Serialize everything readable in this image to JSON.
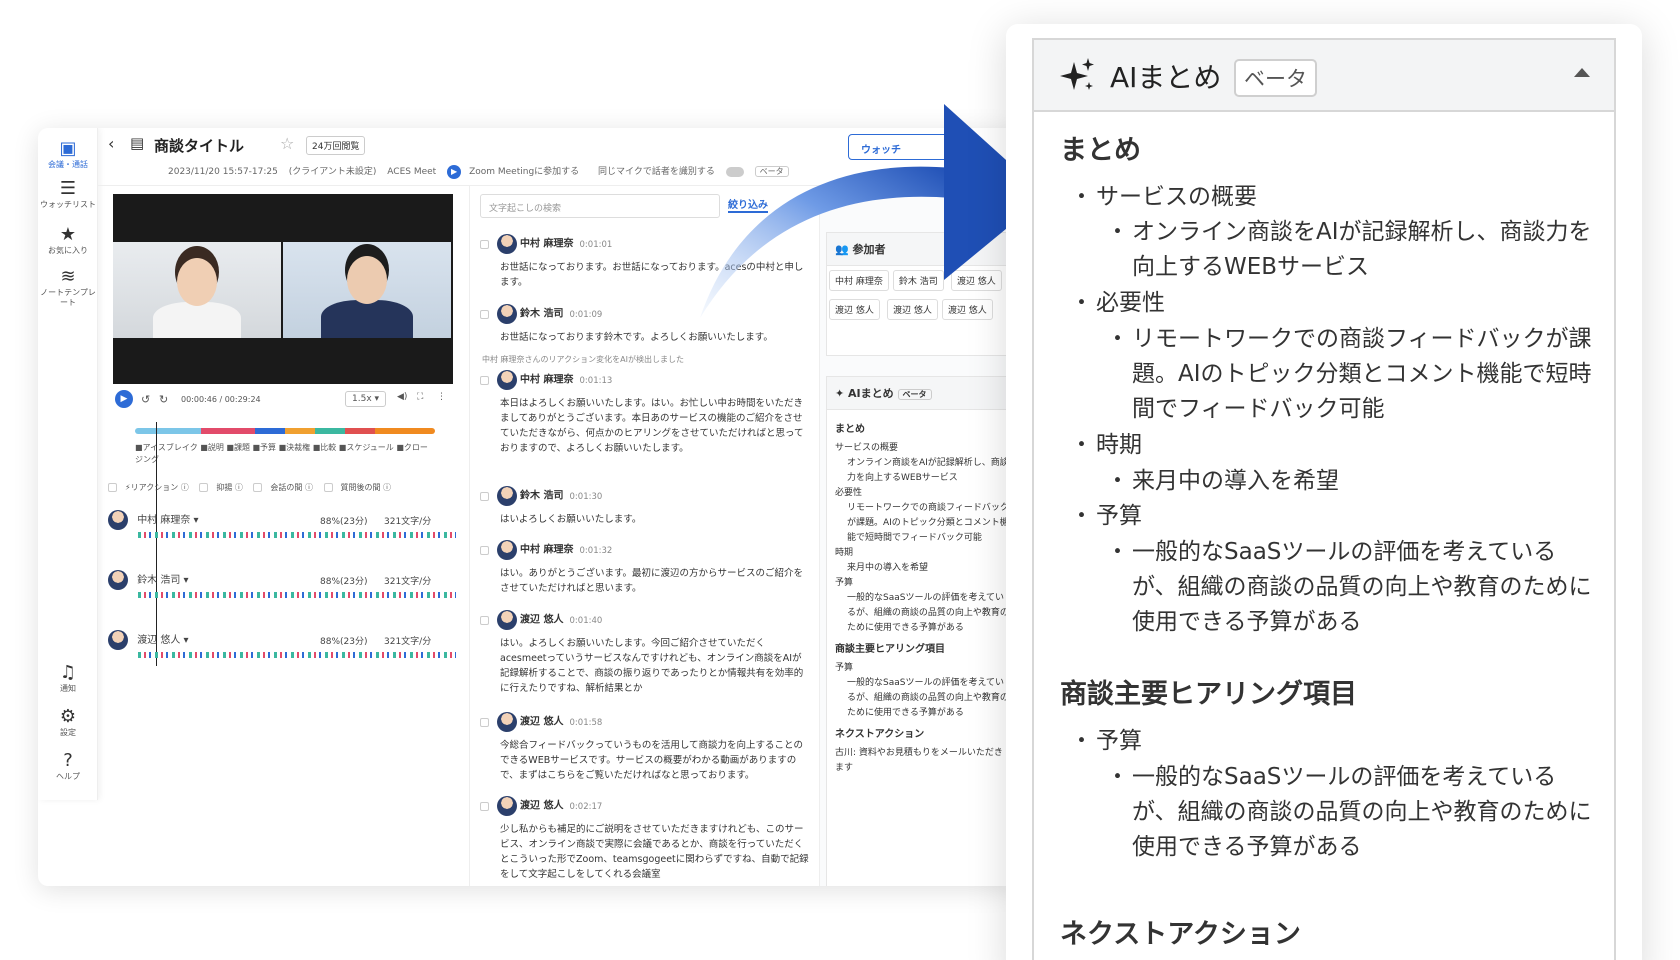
{
  "app": {
    "rail": [
      {
        "icon": "calendar-icon",
        "label": "会議・通話",
        "active": true
      },
      {
        "icon": "list-icon",
        "label": "ウォッチリスト"
      },
      {
        "icon": "star-icon",
        "label": "お気に入り"
      },
      {
        "icon": "database-icon",
        "label": "ノートテンプレート"
      },
      {
        "icon": "bell-icon",
        "label": "通知"
      },
      {
        "icon": "gear-icon",
        "label": "設定"
      },
      {
        "icon": "help-icon",
        "label": "ヘルプ"
      }
    ],
    "header": {
      "title": "商談タイトル",
      "views": "24万回閲覧",
      "datetime": "2023/11/20 15:57-17:25",
      "client": "(クライアント未設定)",
      "tag": "ACES Meet",
      "zoom": "Zoom Meetingに参加する",
      "mic_toggle": "同じマイクで話者を識別する",
      "beta": "ベータ",
      "watch_button": "ウォッチ"
    },
    "player": {
      "time": "00:00:46 / 00:29:24",
      "speed": "1.5x"
    },
    "legend": "■アイスブレイク ■説明 ■課題 ■予算 ■決裁権 ■比較 ■スケジュール ■クロージング",
    "filters": [
      "リアクション",
      "抑揚",
      "会話の間",
      "質問後の間"
    ],
    "speakers": [
      {
        "name": "中村 麻理奈",
        "ratio": "88%(23分)",
        "speed": "321文字/分"
      },
      {
        "name": "鈴木 浩司",
        "ratio": "88%(23分)",
        "speed": "321文字/分"
      },
      {
        "name": "渡辺 悠人",
        "ratio": "88%(23分)",
        "speed": "321文字/分"
      }
    ],
    "transcript": {
      "search_placeholder": "文字起こしの検索",
      "narrow": "絞り込み",
      "reaction_notice": "中村 麻理奈さんのリアクション変化をAIが検出しました",
      "entries": [
        {
          "name": "中村 麻理奈",
          "time": "0:01:01",
          "text": "お世話になっております。お世話になっております。acesの中村と申します。"
        },
        {
          "name": "鈴木 浩司",
          "time": "0:01:09",
          "text": "お世話になっております鈴木です。よろしくお願いいたします。"
        },
        {
          "name": "中村 麻理奈",
          "time": "0:01:13",
          "text": "本日はよろしくお願いいたします。はい。お忙しい中お時間をいただきましてありがとうございます。本日あのサービスの機能のご紹介をさせていただきながら、何点かのヒアリングをさせていただければと思っておりますので、よろしくお願いいたします。"
        },
        {
          "name": "鈴木 浩司",
          "time": "0:01:30",
          "text": "はいよろしくお願いいたします。"
        },
        {
          "name": "中村 麻理奈",
          "time": "0:01:32",
          "text": "はい。ありがとうございます。最初に渡辺の方からサービスのご紹介をさせていただければと思います。"
        },
        {
          "name": "渡辺 悠人",
          "time": "0:01:40",
          "text": "はい。よろしくお願いいたします。今回ご紹介させていただくacesmeetっていうサービスなんですけれども、オンライン商談をAIが記録解析することで、商談の振り返りであったりとか情報共有を効率的に行えたりですね、解析結果とか"
        },
        {
          "name": "渡辺 悠人",
          "time": "0:01:58",
          "text": "今総合フィードバックっていうものを活用して商談力を向上することのできるWEBサービスです。サービスの概要がわかる動画がありますので、まずはこちらをご覧いただければなと思っております。"
        },
        {
          "name": "渡辺 悠人",
          "time": "0:02:17",
          "text": "少し私からも補足的にご説明をさせていただきますけれども、このサービス、オンライン商談で実際に会議であるとか、商談を行っていただくとこういった形でZoom、teamsgogeetに関わらずですね、自動で記録をして文字起こしをしてくれる会議室"
        }
      ]
    },
    "participants": {
      "title": "参加者",
      "chips": [
        "中村 麻理奈",
        "鈴木 浩司",
        "渡辺 悠人",
        "渡辺 悠人",
        "渡辺 悠人",
        "渡辺 悠人"
      ]
    },
    "mini_summary": {
      "title": "AIまとめ",
      "beta": "ベータ",
      "section1": "まとめ",
      "items": [
        "サービスの概要",
        "オンライン商談をAIが記録解析し、商談力を向上するWEBサービス",
        "必要性",
        "リモートワークでの商談フィードバックが課題。AIのトピック分類とコメント機能で短時間でフィードバック可能",
        "時期",
        "来月中の導入を希望",
        "予算",
        "一般的なSaaSツールの評価を考えているが、組織の商談の品質の向上や教育のために使用できる予算がある"
      ],
      "section2": "商談主要ヒアリング項目",
      "s2items": [
        "予算",
        "一般的なSaaSツールの評価を考えているが、組織の商談の品質の向上や教育のために使用できる予算がある"
      ],
      "section3": "ネクストアクション",
      "s3items": [
        "古川: 資料やお見積もりをメールいただきます"
      ]
    }
  },
  "ai_panel": {
    "title": "AIまとめ",
    "beta": "ベータ",
    "section_summary": "まとめ",
    "summary": [
      {
        "label": "サービスの概要",
        "detail": "オンライン商談をAIが記録解析し、商談力を向上するWEBサービス"
      },
      {
        "label": "必要性",
        "detail": "リモートワークでの商談フィードバックが課題。AIのトピック分類とコメント機能で短時間でフィードバック可能"
      },
      {
        "label": "時期",
        "detail": "来月中の導入を希望"
      },
      {
        "label": "予算",
        "detail": "一般的なSaaSツールの評価を考えているが、組織の商談の品質の向上や教育のために使用できる予算がある"
      }
    ],
    "section_hearing": "商談主要ヒアリング項目",
    "hearing": [
      {
        "label": "予算",
        "detail": "一般的なSaaSツールの評価を考えているが、組織の商談の品質の向上や教育のために使用できる予算がある"
      }
    ],
    "section_next": "ネクストアクション"
  },
  "colors": {
    "accent": "#2d6bd6",
    "arrow": "#1f4fb5"
  }
}
